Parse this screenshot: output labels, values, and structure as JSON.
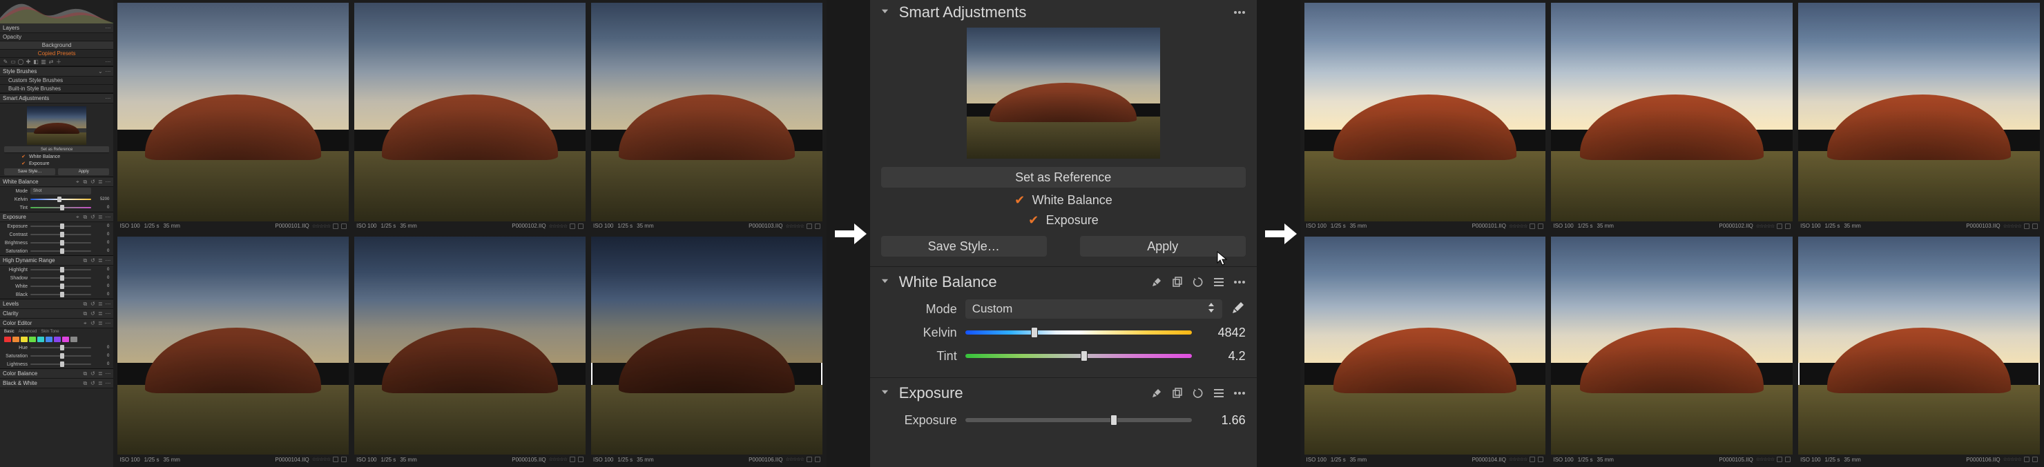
{
  "left_panel": {
    "styleBrushes": {
      "header": "Style Brushes",
      "items": [
        "Custom Style Brushes",
        "Built-in Style Brushes"
      ]
    },
    "smartAdjustments": {
      "header": "Smart Adjustments",
      "setRef": "Set as Reference",
      "checks": [
        "White Balance",
        "Exposure"
      ],
      "saveStyle": "Save Style…",
      "apply": "Apply"
    },
    "whiteBalance": {
      "header": "White Balance",
      "modeLabel": "Mode",
      "modeValue": "Shot",
      "kelvinLabel": "Kelvin",
      "kelvinValue": "5200",
      "tintLabel": "Tint",
      "tintValue": "0"
    },
    "exposure": {
      "header": "Exposure",
      "rows": [
        {
          "label": "Exposure",
          "value": "0"
        },
        {
          "label": "Contrast",
          "value": "0"
        },
        {
          "label": "Brightness",
          "value": "0"
        },
        {
          "label": "Saturation",
          "value": "0"
        }
      ]
    },
    "hdr": {
      "header": "High Dynamic Range",
      "rows": [
        {
          "label": "Highlight",
          "value": "0"
        },
        {
          "label": "Shadow",
          "value": "0"
        },
        {
          "label": "White",
          "value": "0"
        },
        {
          "label": "Black",
          "value": "0"
        }
      ]
    },
    "levels": {
      "header": "Levels"
    },
    "clarity": {
      "header": "Clarity"
    },
    "colorEditor": {
      "header": "Color Editor",
      "tabs": [
        "Basic",
        "Advanced",
        "Skin Tone"
      ],
      "sliders": [
        {
          "label": "Hue",
          "value": "0"
        },
        {
          "label": "Saturation",
          "value": "0"
        },
        {
          "label": "Lightness",
          "value": "0"
        }
      ]
    },
    "colorBalance": {
      "header": "Color Balance"
    },
    "bw": {
      "header": "Black & White"
    },
    "layers": {
      "header": "Layers",
      "opacity": "Opacity",
      "bg": "Background",
      "cp": "Copied Presets"
    }
  },
  "center_panel": {
    "smart": {
      "title": "Smart Adjustments",
      "setRef": "Set as Reference",
      "check1": "White Balance",
      "check2": "Exposure",
      "saveStyle": "Save Style…",
      "apply": "Apply"
    },
    "wb": {
      "title": "White Balance",
      "modeLabel": "Mode",
      "modeValue": "Custom",
      "kelvinLabel": "Kelvin",
      "kelvinValue": "4842",
      "tintLabel": "Tint",
      "tintValue": "4.2"
    },
    "exp": {
      "title": "Exposure",
      "expLabel": "Exposure",
      "expValue": "1.66"
    }
  },
  "thumbs": {
    "iso": "ISO 100",
    "shutter": "1/25 s",
    "focal": "35 mm",
    "files": [
      "P0000101.IIQ",
      "P0000102.IIQ",
      "P0000103.IIQ",
      "P0000104.IIQ",
      "P0000105.IIQ",
      "P0000106.IIQ"
    ]
  },
  "colors": {
    "accent": "#e8742a"
  }
}
